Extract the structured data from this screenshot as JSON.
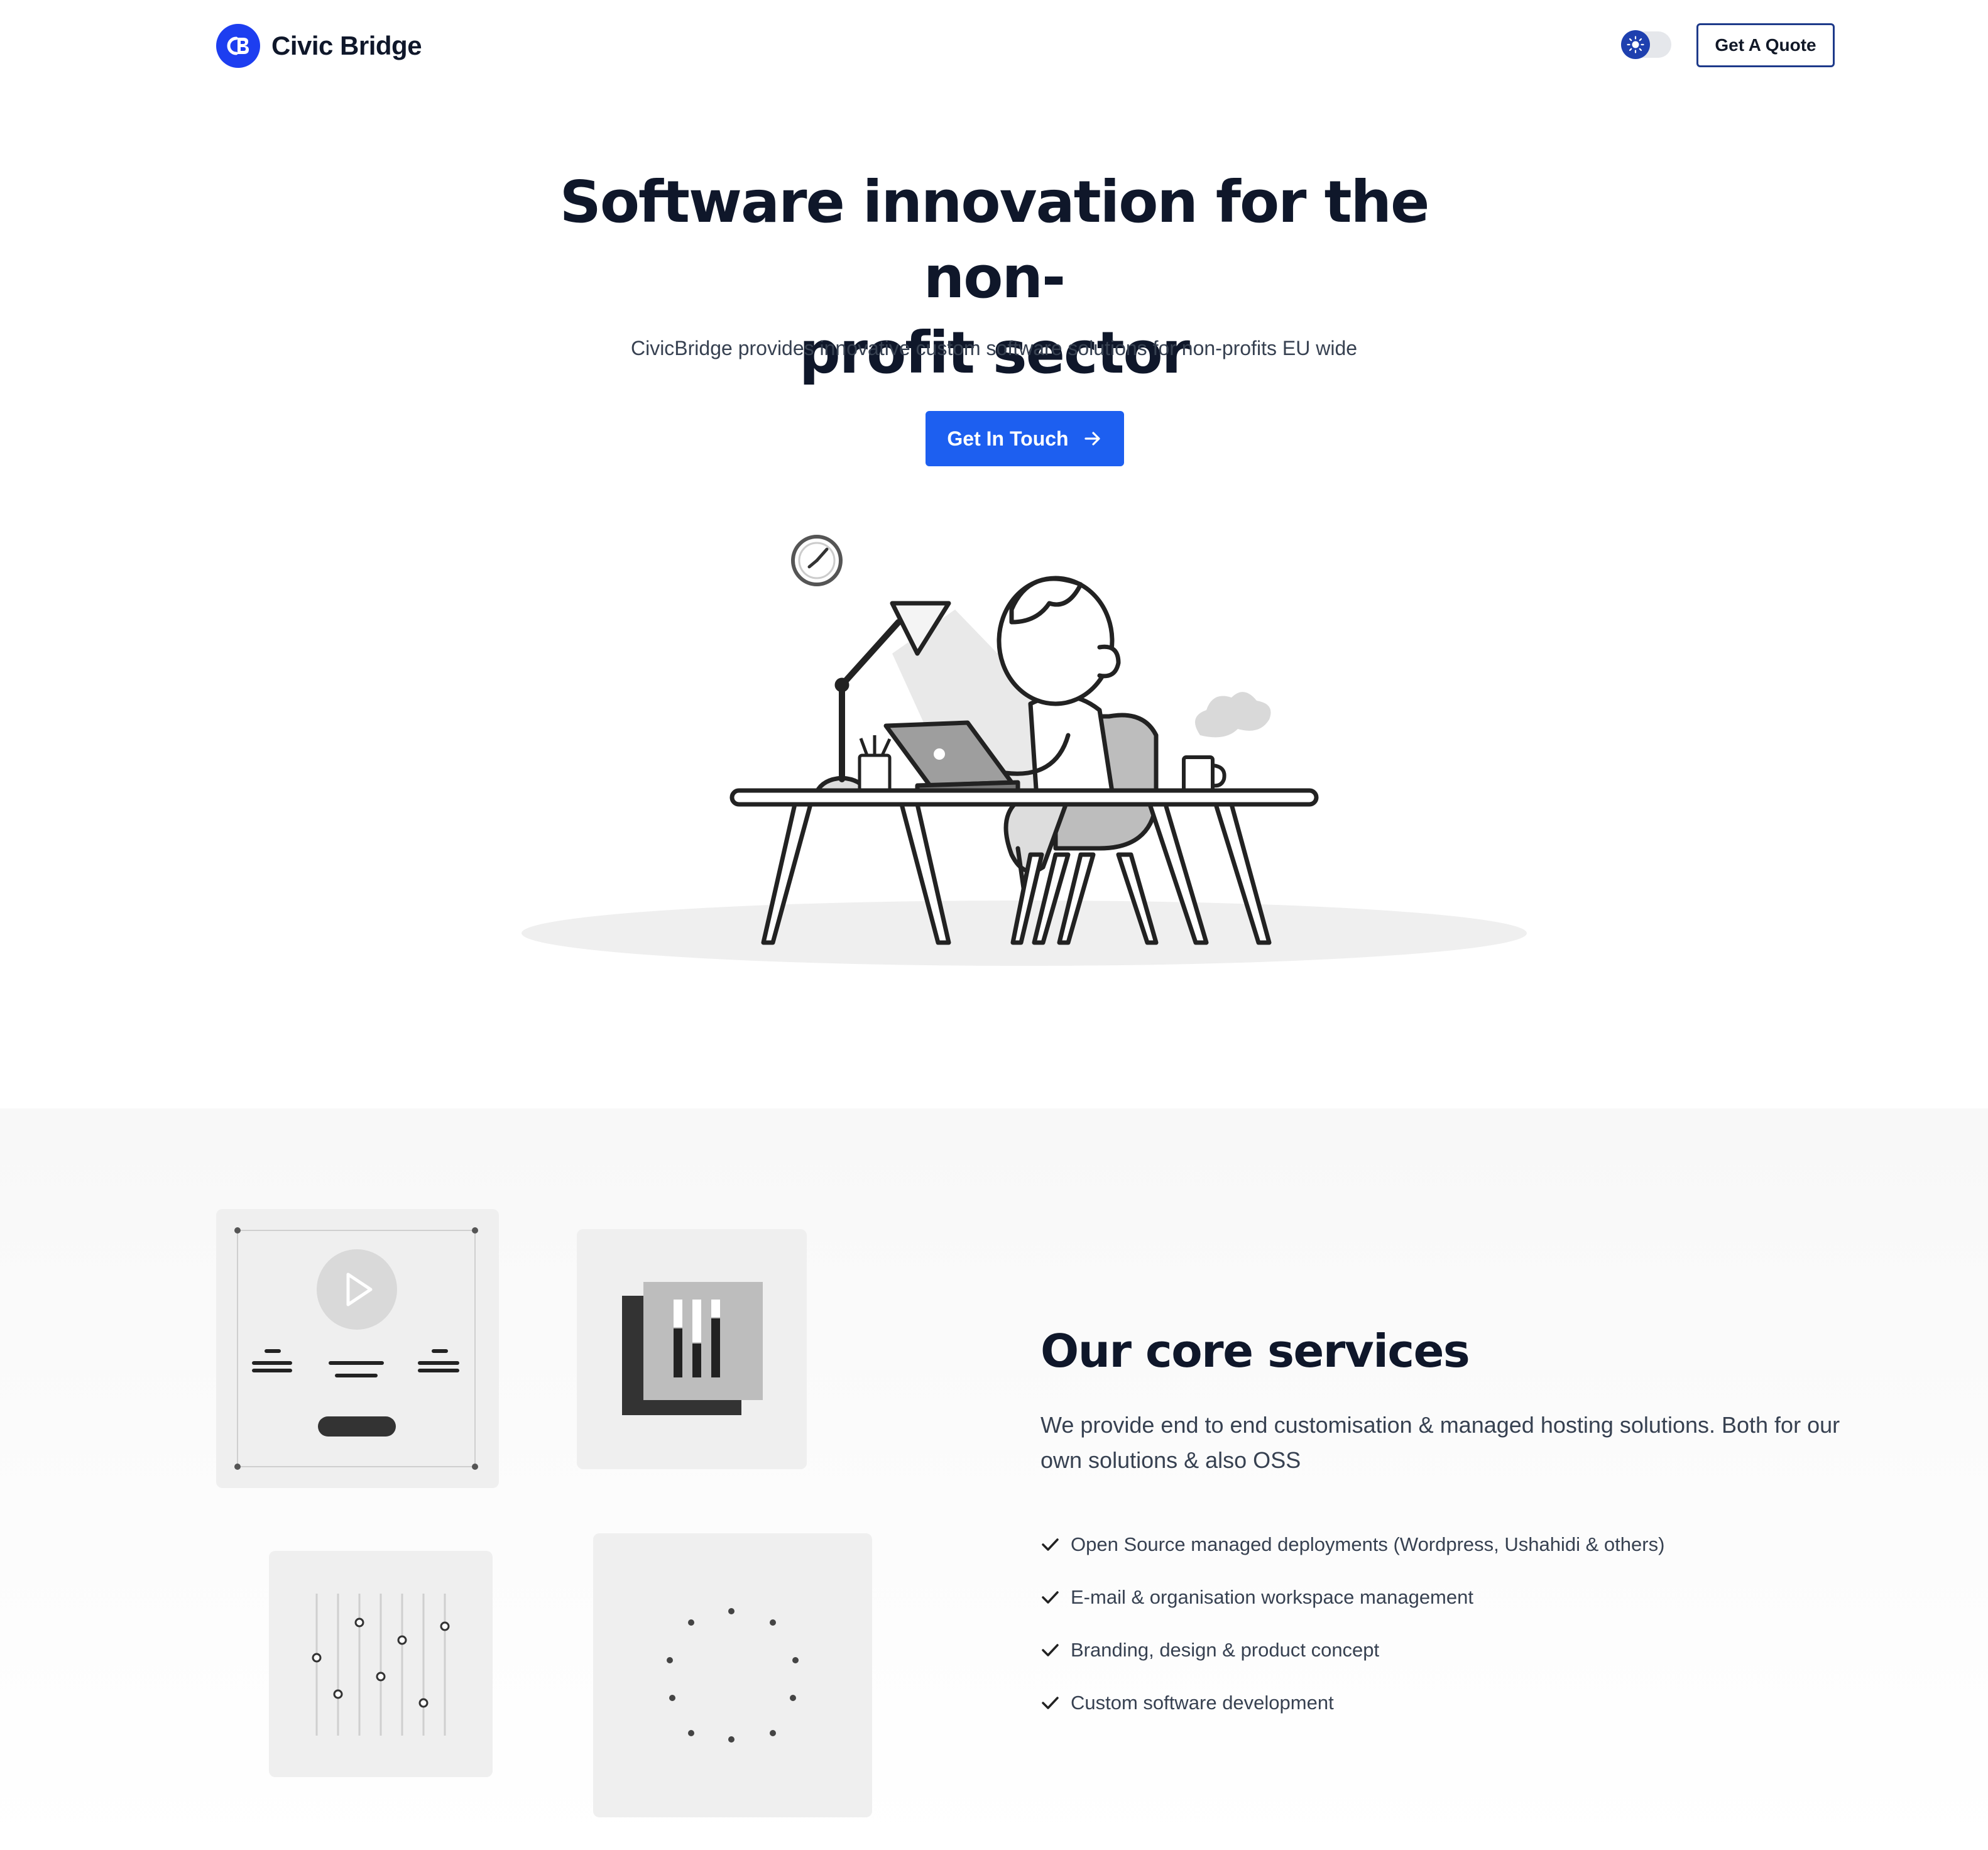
{
  "header": {
    "logo_text": "Civic Bridge",
    "logo_mark_text": "CB",
    "quote_button": "Get A Quote"
  },
  "hero": {
    "title_line1": "Software innovation for the non-",
    "title_line2": "profit sector",
    "subtitle": "CivicBridge provides innovative custom software solutions for non-profits EU wide",
    "cta_label": "Get In Touch"
  },
  "services": {
    "title": "Our core services",
    "description": "We provide end to end customisation & managed hosting solutions. Both for our own solutions & also OSS",
    "items": [
      {
        "label": "Open Source managed deployments (Wordpress, Ushahidi & others)"
      },
      {
        "label": "E-mail & organisation workspace management"
      },
      {
        "label": "Branding, design & product concept"
      },
      {
        "label": "Custom software development"
      }
    ]
  },
  "colors": {
    "brand": "#1d3ef0",
    "cta": "#1d5ff0",
    "heading": "#0f172a",
    "body": "#374151"
  }
}
